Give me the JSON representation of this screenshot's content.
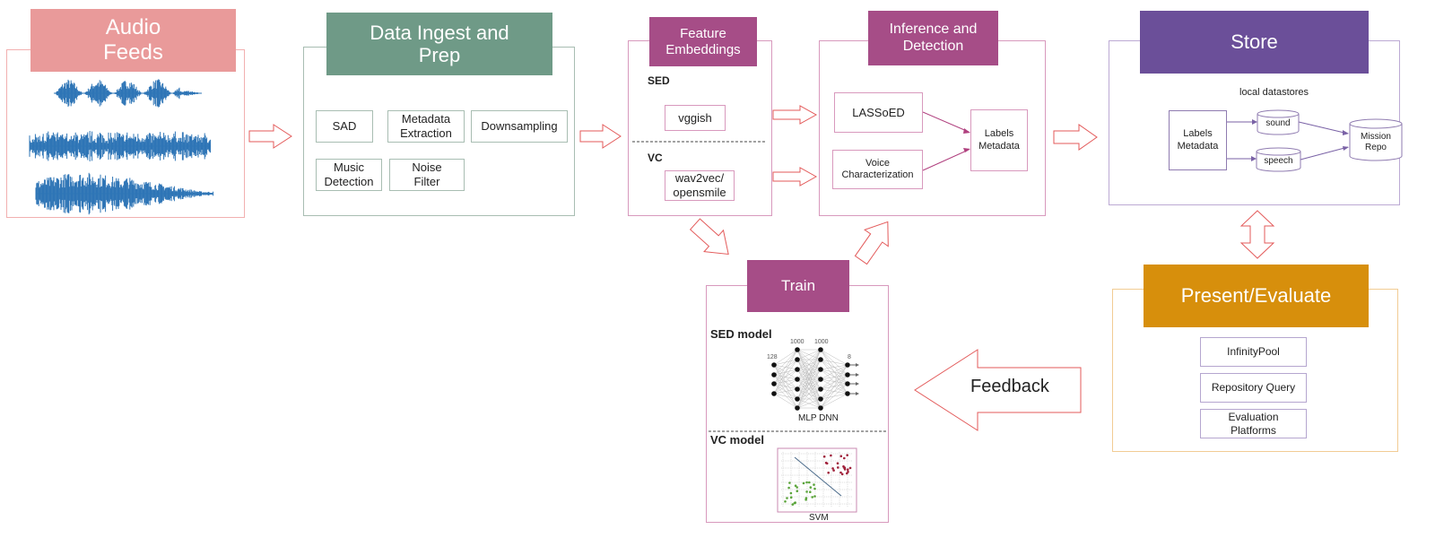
{
  "audio_feeds": {
    "title": "Audio\nFeeds"
  },
  "data_ingest": {
    "title": "Data Ingest and\nPrep",
    "steps": [
      "SAD",
      "Metadata\nExtraction",
      "Downsampling",
      "Music\nDetection",
      "Noise\nFilter"
    ]
  },
  "feature_embeddings": {
    "title": "Feature\nEmbeddings",
    "sed_label": "SED",
    "sed_model": "vggish",
    "vc_label": "VC",
    "vc_model": "wav2vec/\nopensmile"
  },
  "inference": {
    "title": "Inference and\nDetection",
    "lassoed": "LASSoED",
    "voice": "Voice\nCharacterization",
    "labels": "Labels\nMetadata"
  },
  "store": {
    "title": "Store",
    "local_label": "local datastores",
    "labels": "Labels\nMetadata",
    "sound": "sound",
    "speech": "speech",
    "repo": "Mission\nRepo"
  },
  "present": {
    "title": "Present/Evaluate",
    "items": [
      "InfinityPool",
      "Repository Query",
      "Evaluation\nPlatforms"
    ]
  },
  "feedback": "Feedback",
  "train": {
    "title": "Train",
    "sed_model": "SED model",
    "nn_layers": [
      "128",
      "1000",
      "1000",
      "8"
    ],
    "nn_caption": "MLP DNN",
    "vc_model": "VC model",
    "svm_caption": "SVM"
  },
  "colors": {
    "audio_header": "#e99a9a",
    "ingest_header": "#6f9a87",
    "magenta_header": "#a64d87",
    "store_header": "#6b4f99",
    "present_header": "#d78f0c",
    "waveform": "#2e75b6",
    "arrow": "#e35a5a"
  }
}
